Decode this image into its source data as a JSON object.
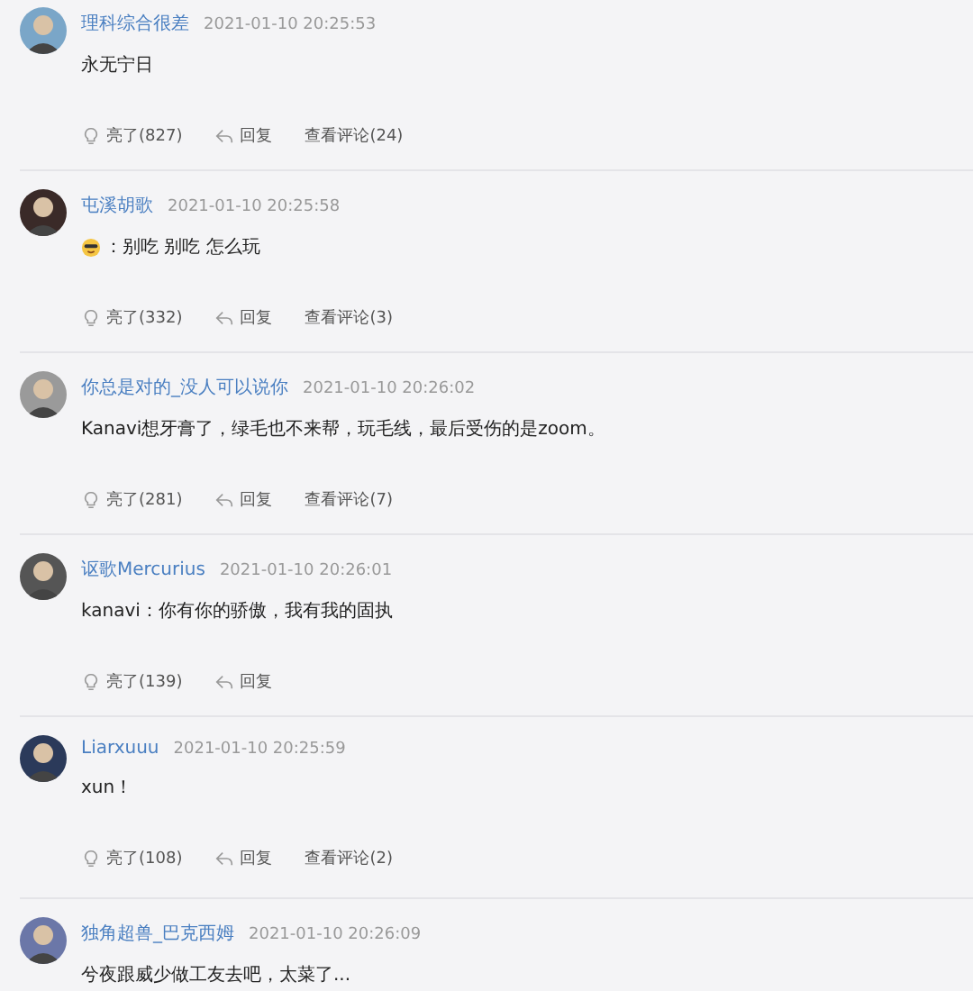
{
  "comments": [
    {
      "user": "理科综合很差",
      "time": "2021-01-10 20:25:53",
      "emoji": false,
      "text": "永无宁日",
      "likes": "亮了(827)",
      "reply": "回复",
      "view_comments": "查看评论(24)"
    },
    {
      "user": "屯溪胡歌",
      "time": "2021-01-10 20:25:58",
      "emoji": true,
      "text": "：别吃 别吃 怎么玩",
      "likes": "亮了(332)",
      "reply": "回复",
      "view_comments": "查看评论(3)"
    },
    {
      "user": "你总是对的_没人可以说你",
      "time": "2021-01-10 20:26:02",
      "emoji": false,
      "text": "Kanavi想牙膏了，绿毛也不来帮，玩毛线，最后受伤的是zoom。",
      "likes": "亮了(281)",
      "reply": "回复",
      "view_comments": "查看评论(7)"
    },
    {
      "user": "讴歌Mercurius",
      "time": "2021-01-10 20:26:01",
      "emoji": false,
      "text": "kanavi：你有你的骄傲，我有我的固执",
      "likes": "亮了(139)",
      "reply": "回复"
    },
    {
      "user": "Liarxuuu",
      "time": "2021-01-10 20:25:59",
      "emoji": false,
      "text": "xun！",
      "likes": "亮了(108)",
      "reply": "回复",
      "view_comments": "查看评论(2)"
    },
    {
      "user": "独角超兽_巴克西姆",
      "time": "2021-01-10 20:26:09",
      "emoji": false,
      "text": "兮夜跟威少做工友去吧，太菜了..."
    }
  ]
}
